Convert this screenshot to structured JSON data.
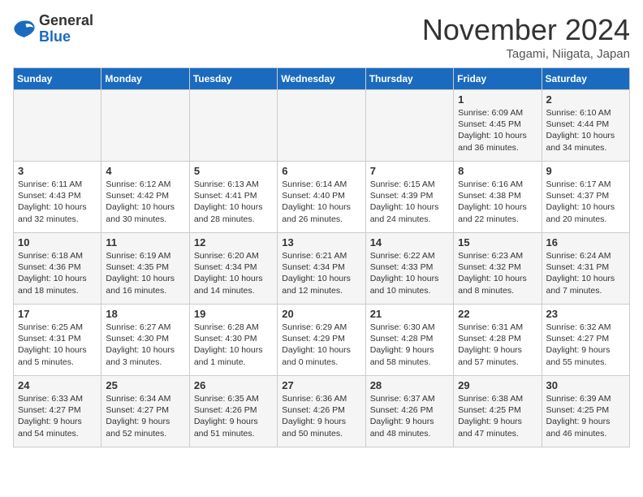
{
  "logo": {
    "general": "General",
    "blue": "Blue"
  },
  "header": {
    "month": "November 2024",
    "location": "Tagami, Niigata, Japan"
  },
  "weekdays": [
    "Sunday",
    "Monday",
    "Tuesday",
    "Wednesday",
    "Thursday",
    "Friday",
    "Saturday"
  ],
  "weeks": [
    [
      {
        "day": "",
        "info": ""
      },
      {
        "day": "",
        "info": ""
      },
      {
        "day": "",
        "info": ""
      },
      {
        "day": "",
        "info": ""
      },
      {
        "day": "",
        "info": ""
      },
      {
        "day": "1",
        "info": "Sunrise: 6:09 AM\nSunset: 4:45 PM\nDaylight: 10 hours and 36 minutes."
      },
      {
        "day": "2",
        "info": "Sunrise: 6:10 AM\nSunset: 4:44 PM\nDaylight: 10 hours and 34 minutes."
      }
    ],
    [
      {
        "day": "3",
        "info": "Sunrise: 6:11 AM\nSunset: 4:43 PM\nDaylight: 10 hours and 32 minutes."
      },
      {
        "day": "4",
        "info": "Sunrise: 6:12 AM\nSunset: 4:42 PM\nDaylight: 10 hours and 30 minutes."
      },
      {
        "day": "5",
        "info": "Sunrise: 6:13 AM\nSunset: 4:41 PM\nDaylight: 10 hours and 28 minutes."
      },
      {
        "day": "6",
        "info": "Sunrise: 6:14 AM\nSunset: 4:40 PM\nDaylight: 10 hours and 26 minutes."
      },
      {
        "day": "7",
        "info": "Sunrise: 6:15 AM\nSunset: 4:39 PM\nDaylight: 10 hours and 24 minutes."
      },
      {
        "day": "8",
        "info": "Sunrise: 6:16 AM\nSunset: 4:38 PM\nDaylight: 10 hours and 22 minutes."
      },
      {
        "day": "9",
        "info": "Sunrise: 6:17 AM\nSunset: 4:37 PM\nDaylight: 10 hours and 20 minutes."
      }
    ],
    [
      {
        "day": "10",
        "info": "Sunrise: 6:18 AM\nSunset: 4:36 PM\nDaylight: 10 hours and 18 minutes."
      },
      {
        "day": "11",
        "info": "Sunrise: 6:19 AM\nSunset: 4:35 PM\nDaylight: 10 hours and 16 minutes."
      },
      {
        "day": "12",
        "info": "Sunrise: 6:20 AM\nSunset: 4:34 PM\nDaylight: 10 hours and 14 minutes."
      },
      {
        "day": "13",
        "info": "Sunrise: 6:21 AM\nSunset: 4:34 PM\nDaylight: 10 hours and 12 minutes."
      },
      {
        "day": "14",
        "info": "Sunrise: 6:22 AM\nSunset: 4:33 PM\nDaylight: 10 hours and 10 minutes."
      },
      {
        "day": "15",
        "info": "Sunrise: 6:23 AM\nSunset: 4:32 PM\nDaylight: 10 hours and 8 minutes."
      },
      {
        "day": "16",
        "info": "Sunrise: 6:24 AM\nSunset: 4:31 PM\nDaylight: 10 hours and 7 minutes."
      }
    ],
    [
      {
        "day": "17",
        "info": "Sunrise: 6:25 AM\nSunset: 4:31 PM\nDaylight: 10 hours and 5 minutes."
      },
      {
        "day": "18",
        "info": "Sunrise: 6:27 AM\nSunset: 4:30 PM\nDaylight: 10 hours and 3 minutes."
      },
      {
        "day": "19",
        "info": "Sunrise: 6:28 AM\nSunset: 4:30 PM\nDaylight: 10 hours and 1 minute."
      },
      {
        "day": "20",
        "info": "Sunrise: 6:29 AM\nSunset: 4:29 PM\nDaylight: 10 hours and 0 minutes."
      },
      {
        "day": "21",
        "info": "Sunrise: 6:30 AM\nSunset: 4:28 PM\nDaylight: 9 hours and 58 minutes."
      },
      {
        "day": "22",
        "info": "Sunrise: 6:31 AM\nSunset: 4:28 PM\nDaylight: 9 hours and 57 minutes."
      },
      {
        "day": "23",
        "info": "Sunrise: 6:32 AM\nSunset: 4:27 PM\nDaylight: 9 hours and 55 minutes."
      }
    ],
    [
      {
        "day": "24",
        "info": "Sunrise: 6:33 AM\nSunset: 4:27 PM\nDaylight: 9 hours and 54 minutes."
      },
      {
        "day": "25",
        "info": "Sunrise: 6:34 AM\nSunset: 4:27 PM\nDaylight: 9 hours and 52 minutes."
      },
      {
        "day": "26",
        "info": "Sunrise: 6:35 AM\nSunset: 4:26 PM\nDaylight: 9 hours and 51 minutes."
      },
      {
        "day": "27",
        "info": "Sunrise: 6:36 AM\nSunset: 4:26 PM\nDaylight: 9 hours and 50 minutes."
      },
      {
        "day": "28",
        "info": "Sunrise: 6:37 AM\nSunset: 4:26 PM\nDaylight: 9 hours and 48 minutes."
      },
      {
        "day": "29",
        "info": "Sunrise: 6:38 AM\nSunset: 4:25 PM\nDaylight: 9 hours and 47 minutes."
      },
      {
        "day": "30",
        "info": "Sunrise: 6:39 AM\nSunset: 4:25 PM\nDaylight: 9 hours and 46 minutes."
      }
    ]
  ]
}
